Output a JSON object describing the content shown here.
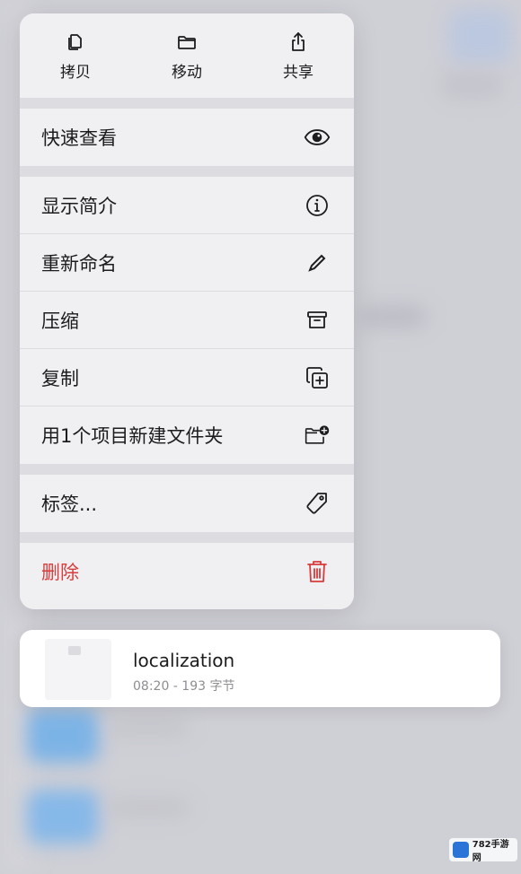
{
  "top_actions": [
    {
      "label": "拷贝",
      "icon": "copy-doc-icon"
    },
    {
      "label": "移动",
      "icon": "folder-icon"
    },
    {
      "label": "共享",
      "icon": "share-icon"
    }
  ],
  "quick_look": {
    "label": "快速查看",
    "icon": "eye-icon"
  },
  "group2": [
    {
      "label": "显示简介",
      "icon": "info-icon"
    },
    {
      "label": "重新命名",
      "icon": "pencil-icon"
    },
    {
      "label": "压缩",
      "icon": "archive-icon"
    },
    {
      "label": "复制",
      "icon": "duplicate-icon"
    },
    {
      "label": "用1个项目新建文件夹",
      "icon": "folder-plus-icon"
    }
  ],
  "tags": {
    "label": "标签...",
    "icon": "tag-icon"
  },
  "delete": {
    "label": "删除",
    "icon": "trash-icon",
    "color": "#d83b3b"
  },
  "file": {
    "name": "localization",
    "meta": "08:20 - 193 字节"
  },
  "watermark": {
    "text": "782手游网"
  }
}
